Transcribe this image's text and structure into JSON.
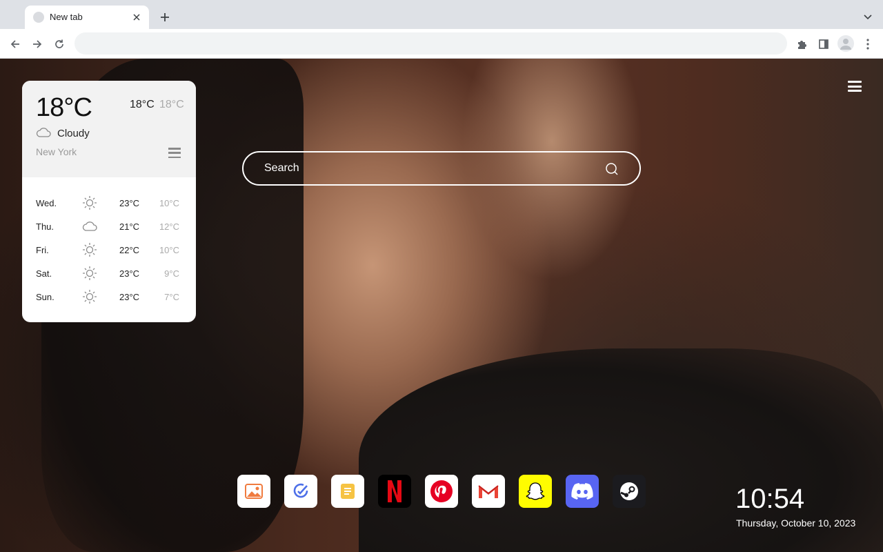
{
  "browser": {
    "tab": {
      "title": "New tab"
    },
    "omnibox": {
      "value": "",
      "placeholder": ""
    }
  },
  "weather": {
    "current": {
      "temp": "18°C",
      "high": "18°C",
      "low": "18°C",
      "condition": "Cloudy",
      "condition_icon": "cloud-icon",
      "city": "New York"
    },
    "forecast": [
      {
        "day": "Wed.",
        "icon": "sun-icon",
        "high": "23°C",
        "low": "10°C"
      },
      {
        "day": "Thu.",
        "icon": "cloud-icon",
        "high": "21°C",
        "low": "12°C"
      },
      {
        "day": "Fri.",
        "icon": "sun-icon",
        "high": "22°C",
        "low": "10°C"
      },
      {
        "day": "Sat.",
        "icon": "sun-icon",
        "high": "23°C",
        "low": "9°C"
      },
      {
        "day": "Sun.",
        "icon": "sun-icon",
        "high": "23°C",
        "low": "7°C"
      }
    ]
  },
  "search": {
    "placeholder": "Search"
  },
  "dock": [
    {
      "name": "photos",
      "icon": "photos-icon",
      "bg": "#ffffff"
    },
    {
      "name": "tasks",
      "icon": "check-icon",
      "bg": "#ffffff"
    },
    {
      "name": "notes",
      "icon": "notes-icon",
      "bg": "#ffffff"
    },
    {
      "name": "netflix",
      "icon": "netflix-icon",
      "bg": "#000000"
    },
    {
      "name": "pinterest",
      "icon": "pinterest-icon",
      "bg": "#ffffff"
    },
    {
      "name": "gmail",
      "icon": "gmail-icon",
      "bg": "#ffffff"
    },
    {
      "name": "snapchat",
      "icon": "snapchat-icon",
      "bg": "#fffc00"
    },
    {
      "name": "discord",
      "icon": "discord-icon",
      "bg": "#5865f2"
    },
    {
      "name": "steam",
      "icon": "steam-icon",
      "bg": "#1b1b1f"
    }
  ],
  "clock": {
    "time": "10:54",
    "date": "Thursday, October 10, 2023"
  }
}
